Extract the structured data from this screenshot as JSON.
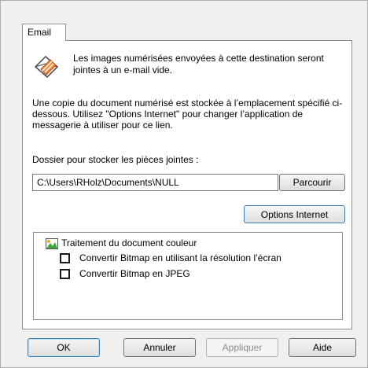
{
  "tabs": [
    {
      "label": "Email"
    }
  ],
  "info": {
    "icon": "email-envelope-icon",
    "text": "Les images numérisées envoyées à cette destination seront jointes à un e-mail vide."
  },
  "description": "Une copie du document numérisé est stockée à l’emplacement spécifié ci-dessous. Utilisez \"Options Internet\" pour changer l’application de messagerie à utiliser pour ce lien.",
  "folder": {
    "label": "Dossier pour stocker les pièces jointes :",
    "value": "C:\\Users\\RHolz\\Documents\\NULL",
    "browse_label": "Parcourir"
  },
  "options_internet_label": "Options Internet",
  "color_processing": {
    "icon": "color-document-icon",
    "title": "Traitement du document couleur",
    "options": [
      {
        "label": "Convertir Bitmap en utilisant la résolution l’écran",
        "checked": false
      },
      {
        "label": "Convertir Bitmap en JPEG",
        "checked": false
      }
    ]
  },
  "footer": {
    "ok_label": "OK",
    "cancel_label": "Annuler",
    "apply_label": "Appliquer",
    "help_label": "Aide"
  },
  "colors": {
    "background": "#f0f0f0",
    "panel": "#ffffff",
    "default_button_border": "#3c7fb1",
    "disabled_text": "#8d8d8d"
  }
}
